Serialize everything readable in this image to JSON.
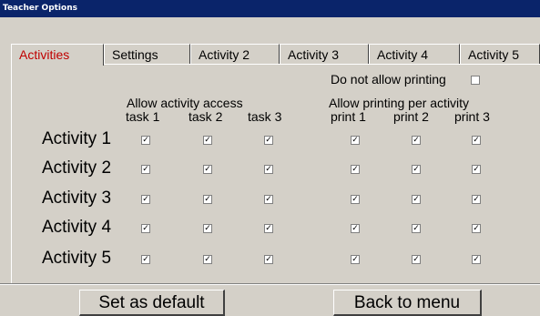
{
  "window": {
    "title": "Teacher Options"
  },
  "tabs": [
    {
      "label": "Activities",
      "active": true
    },
    {
      "label": "Settings"
    },
    {
      "label": "Activity 2"
    },
    {
      "label": "Activity 3"
    },
    {
      "label": "Activity 4"
    },
    {
      "label": "Activity 5"
    }
  ],
  "no_printing": {
    "label": "Do not allow printing",
    "checked": false
  },
  "access": {
    "heading": "Allow activity access",
    "columns": [
      "task 1",
      "task 2",
      "task 3"
    ]
  },
  "printing": {
    "heading": "Allow printing per activity",
    "columns": [
      "print 1",
      "print 2",
      "print 3"
    ]
  },
  "rows": [
    {
      "label": "Activity 1",
      "tasks": [
        true,
        true,
        true
      ],
      "prints": [
        true,
        true,
        true
      ]
    },
    {
      "label": "Activity 2",
      "tasks": [
        true,
        true,
        true
      ],
      "prints": [
        true,
        true,
        true
      ]
    },
    {
      "label": "Activity 3",
      "tasks": [
        true,
        true,
        true
      ],
      "prints": [
        true,
        true,
        true
      ]
    },
    {
      "label": "Activity 4",
      "tasks": [
        true,
        true,
        true
      ],
      "prints": [
        true,
        true,
        true
      ]
    },
    {
      "label": "Activity 5",
      "tasks": [
        true,
        true,
        true
      ],
      "prints": [
        true,
        true,
        true
      ]
    }
  ],
  "buttons": {
    "set_default": "Set as default",
    "back": "Back to menu"
  },
  "check_glyph": "✓",
  "colors": {
    "titlebar": "#0a246a",
    "active_tab": "#c00000",
    "face": "#d4d0c8"
  }
}
